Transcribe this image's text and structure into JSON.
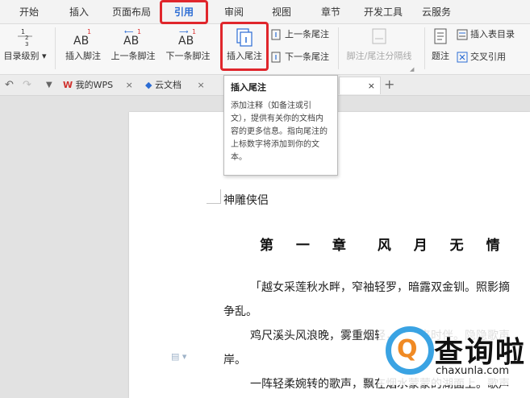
{
  "menu": {
    "tabs": [
      "开始",
      "插入",
      "页面布局",
      "引用",
      "审阅",
      "视图",
      "章节",
      "开发工具",
      "云服务"
    ],
    "active_index": 3
  },
  "ribbon": {
    "toc_level": "目录级别",
    "insert_footnote": "插入脚注",
    "prev_footnote": "上一条脚注",
    "next_footnote": "下一条脚注",
    "insert_endnote": "插入尾注",
    "prev_endnote": "上一条尾注",
    "next_endnote": "下一条尾注",
    "footnote_separator": "脚注/尾注分隔线",
    "caption": "题注",
    "insert_table_of_figures": "插入表目录",
    "cross_reference": "交叉引用",
    "icon_numbers": {
      "one": "1",
      "two": "2",
      "three": "3"
    },
    "ab_text": "AB"
  },
  "tabstrip": {
    "tabs": [
      {
        "label": "我的WPS",
        "close": "×"
      },
      {
        "label": "云文档",
        "close": "×"
      }
    ],
    "active_close": "×",
    "add": "+"
  },
  "tooltip": {
    "title": "插入尾注",
    "body": "添加注释（如备注或引文），提供有关你的文档内容的更多信息。指向尾注的上标数字将添加到你的文本。"
  },
  "document": {
    "title_line": "神雕侠侣",
    "heading": "第 一 章　风 月 无 情",
    "line1": "「越女采莲秋水畔，窄袖轻罗，暗露双金钏。照影摘",
    "line2": "争乱。",
    "line3": "鸡尺溪头风浪晚，雾重烟轻，不见来时伴。隐隐歌声",
    "line4": "岸。",
    "line5": "一阵轻柔婉转的歌声，飘在烟水蒙蒙的湖面上。歌声"
  },
  "watermark": {
    "mark": "Q",
    "text": "查询啦",
    "url": "chaxunla.com"
  },
  "colors": {
    "accent": "#2b6cd4",
    "highlight": "#e0262c",
    "watermark_blue": "#3aa3e3",
    "watermark_orange": "#f08a24"
  }
}
